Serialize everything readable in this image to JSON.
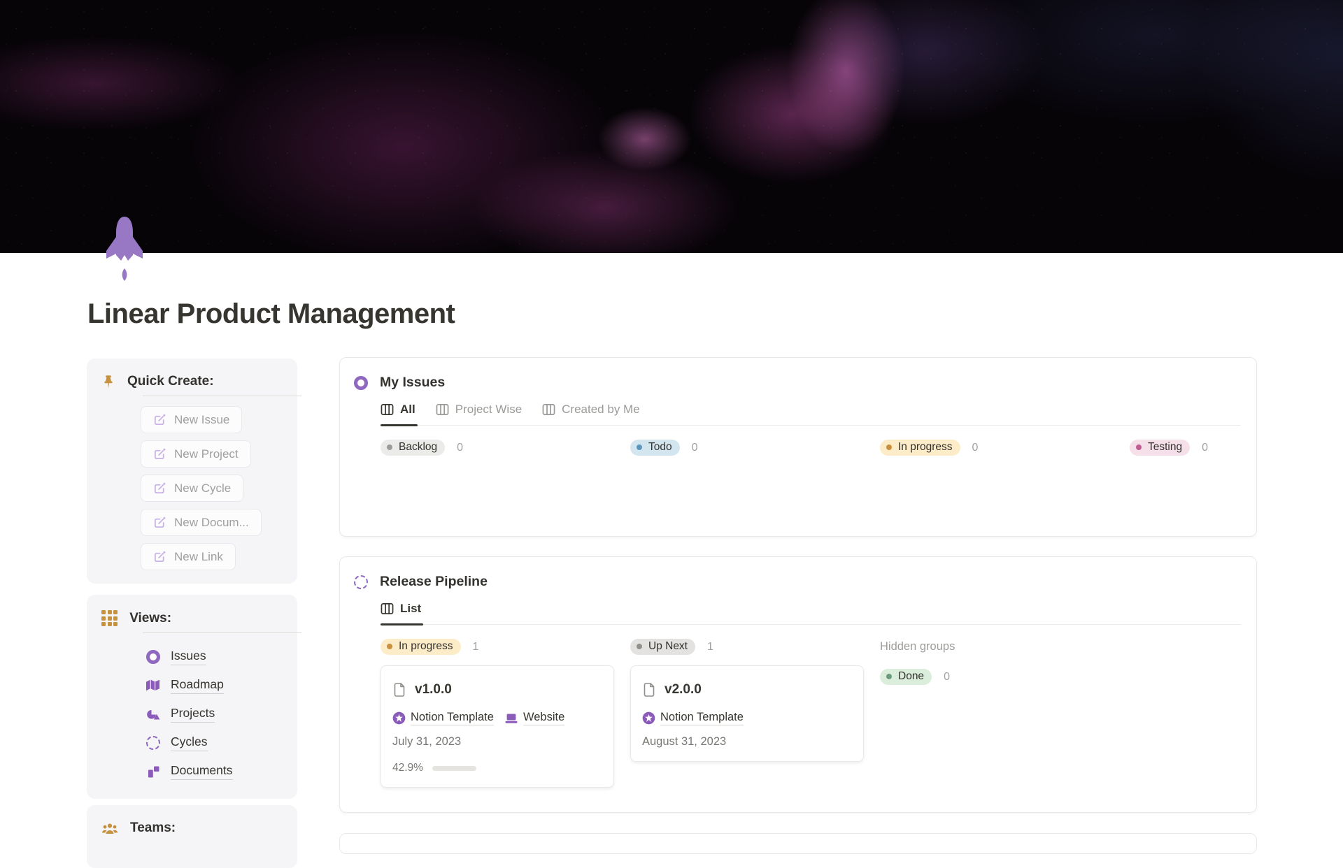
{
  "page": {
    "title": "Linear Product Management"
  },
  "sidebar": {
    "quick_create": {
      "title": "Quick Create:",
      "buttons": [
        {
          "label": "New Issue"
        },
        {
          "label": "New Project"
        },
        {
          "label": "New Cycle"
        },
        {
          "label": "New Docum..."
        },
        {
          "label": "New Link"
        }
      ]
    },
    "views": {
      "title": "Views:",
      "items": [
        {
          "label": "Issues"
        },
        {
          "label": "Roadmap"
        },
        {
          "label": "Projects"
        },
        {
          "label": "Cycles"
        },
        {
          "label": "Documents"
        }
      ]
    },
    "teams": {
      "title": "Teams:"
    }
  },
  "my_issues": {
    "title": "My Issues",
    "tabs": [
      {
        "label": "All",
        "active": true
      },
      {
        "label": "Project Wise",
        "active": false
      },
      {
        "label": "Created by Me",
        "active": false
      }
    ],
    "groups": [
      {
        "label": "Backlog",
        "count": "0"
      },
      {
        "label": "Todo",
        "count": "0"
      },
      {
        "label": "In progress",
        "count": "0"
      },
      {
        "label": "Testing",
        "count": "0"
      }
    ]
  },
  "release_pipeline": {
    "title": "Release Pipeline",
    "tabs": [
      {
        "label": "List",
        "active": true
      }
    ],
    "groups": [
      {
        "label": "In progress",
        "count": "1"
      },
      {
        "label": "Up Next",
        "count": "1"
      }
    ],
    "hidden_groups_label": "Hidden groups",
    "done_group": {
      "label": "Done",
      "count": "0"
    },
    "cards": [
      {
        "title": "v1.0.0",
        "links": [
          {
            "label": "Notion Template"
          },
          {
            "label": "Website"
          }
        ],
        "date": "July 31, 2023",
        "progress_label": "42.9%",
        "progress_pct": 42.9
      },
      {
        "title": "v2.0.0",
        "links": [
          {
            "label": "Notion Template"
          }
        ],
        "date": "August 31, 2023"
      }
    ]
  },
  "colors": {
    "accent_purple": "#8a5bb8",
    "rocket_purple": "#9878c4",
    "icon_gold": "#c69240",
    "text_dark": "#37352f",
    "text_gray": "#787774",
    "text_light_gray": "#9b9a97",
    "status_backlog_bg": "#ebebe9",
    "status_backlog_dot": "#9c9b99",
    "status_todo_bg": "#d3e5ef",
    "status_todo_dot": "#5b97bd",
    "status_in_progress_bg": "#fdecc8",
    "status_in_progress_dot": "#c9913f",
    "status_testing_bg": "#f5e0e9",
    "status_testing_dot": "#c05c94",
    "status_up_next_bg": "#e3e2e0",
    "status_up_next_dot": "#90908c",
    "status_done_bg": "#dbeddb",
    "status_done_dot": "#6c9b81",
    "progress_fill": "#699b75"
  }
}
